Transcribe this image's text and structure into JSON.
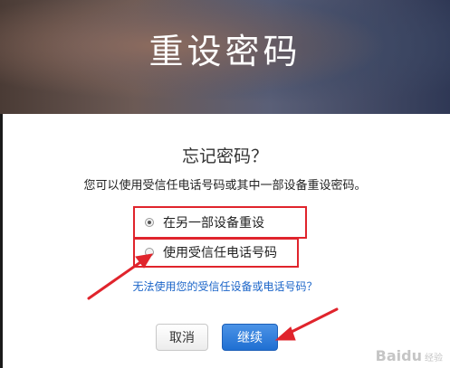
{
  "header": {
    "title": "重设密码"
  },
  "question": "忘记密码？",
  "description": "您可以使用受信任电话号码或其中一部设备重设密码。",
  "options": [
    {
      "label": "在另一部设备重设",
      "selected": true
    },
    {
      "label": "使用受信任电话号码",
      "selected": false
    }
  ],
  "help_link": "无法使用您的受信任设备或电话号码？",
  "buttons": {
    "cancel": "取消",
    "continue": "继续"
  },
  "watermark": {
    "brand": "Baidu",
    "suffix": "经验"
  },
  "colors": {
    "annotation": "#e0242c",
    "link": "#1a64c8",
    "primary": "#1f6fd2"
  }
}
